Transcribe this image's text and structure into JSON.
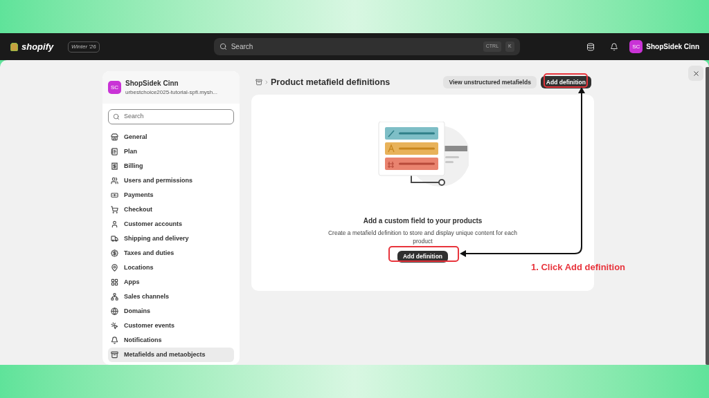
{
  "topbar": {
    "logo": "shopify",
    "badge": "Winter '26",
    "search": {
      "placeholder": "Search",
      "shortcut": [
        "CTRL",
        "K"
      ]
    },
    "user": {
      "initials": "SC",
      "name": "ShopSidek Cinn"
    }
  },
  "sidebar": {
    "store": {
      "initials": "SC",
      "name": "ShopSidek Cinn",
      "domain": "urbestchoice2025-tutorial-spfi.mysh..."
    },
    "search": {
      "placeholder": "Search"
    },
    "items": [
      {
        "label": "General",
        "selected": false
      },
      {
        "label": "Plan",
        "selected": false
      },
      {
        "label": "Billing",
        "selected": false
      },
      {
        "label": "Users and permissions",
        "selected": false
      },
      {
        "label": "Payments",
        "selected": false
      },
      {
        "label": "Checkout",
        "selected": false
      },
      {
        "label": "Customer accounts",
        "selected": false
      },
      {
        "label": "Shipping and delivery",
        "selected": false
      },
      {
        "label": "Taxes and duties",
        "selected": false
      },
      {
        "label": "Locations",
        "selected": false
      },
      {
        "label": "Apps",
        "selected": false
      },
      {
        "label": "Sales channels",
        "selected": false
      },
      {
        "label": "Domains",
        "selected": false
      },
      {
        "label": "Customer events",
        "selected": false
      },
      {
        "label": "Notifications",
        "selected": false
      },
      {
        "label": "Metafields and metaobjects",
        "selected": true
      }
    ]
  },
  "page": {
    "title": "Product metafield definitions",
    "actions": [
      {
        "label": "View unstructured metafields",
        "kind": "secondary"
      },
      {
        "label": "Add definition",
        "kind": "primary"
      }
    ],
    "empty_state": {
      "heading": "Add a custom field to your products",
      "text": "Create a metafield definition to store and display unique content for each product",
      "button": "Add definition"
    }
  },
  "annotation": {
    "text": "1. Click Add definition"
  }
}
